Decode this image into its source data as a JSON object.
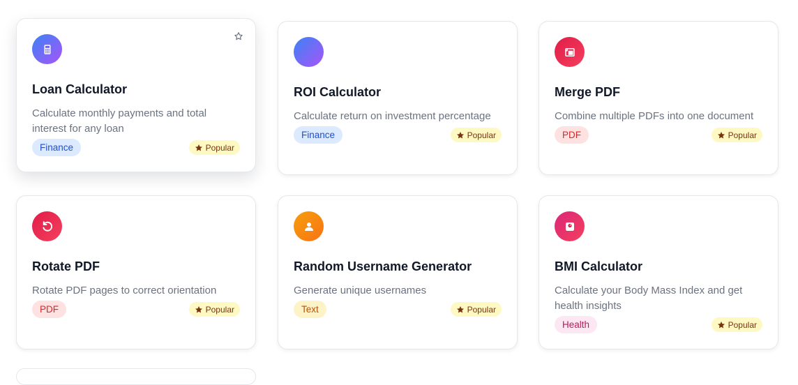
{
  "popular_label": "Popular",
  "cards": [
    {
      "title": "Loan Calculator",
      "description": "Calculate monthly payments and total interest for any loan",
      "tag": "Finance",
      "icon": "calculator-icon",
      "icon_gradient": [
        "#3b82f6",
        "#a855f7"
      ]
    },
    {
      "title": "ROI Calculator",
      "description": "Calculate return on investment percentage",
      "tag": "Finance",
      "icon": "blank-icon",
      "icon_gradient": [
        "#3b82f6",
        "#a855f7"
      ]
    },
    {
      "title": "Merge PDF",
      "description": "Combine multiple PDFs into one document",
      "tag": "PDF",
      "icon": "merge-icon",
      "icon_gradient": [
        "#e11d48",
        "#f43f5e"
      ]
    },
    {
      "title": "Rotate PDF",
      "description": "Rotate PDF pages to correct orientation",
      "tag": "PDF",
      "icon": "rotate-icon",
      "icon_gradient": [
        "#e11d48",
        "#f43f5e"
      ]
    },
    {
      "title": "Random Username Generator",
      "description": "Generate unique usernames",
      "tag": "Text",
      "icon": "user-icon",
      "icon_gradient": [
        "#f59e0b",
        "#f97316"
      ]
    },
    {
      "title": "BMI Calculator",
      "description": "Calculate your Body Mass Index and get health insights",
      "tag": "Health",
      "icon": "scale-icon",
      "icon_gradient": [
        "#db2777",
        "#f43f5e"
      ]
    }
  ]
}
